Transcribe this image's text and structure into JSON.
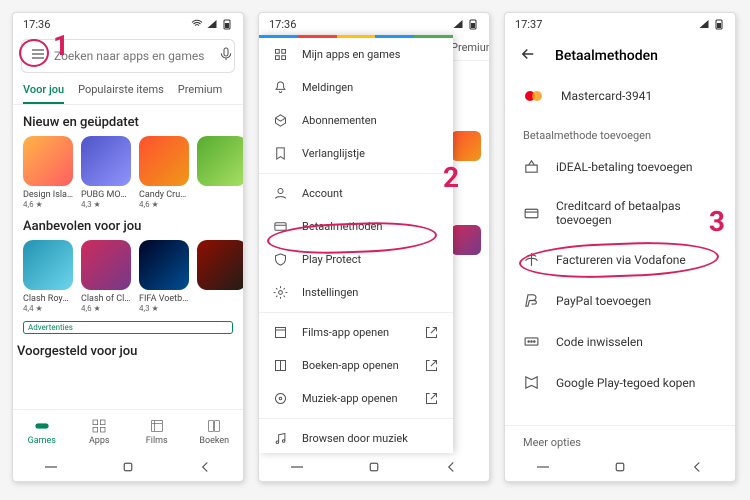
{
  "status": {
    "time1": "17:36",
    "time2": "17:36",
    "time3": "17:37"
  },
  "annotations": {
    "n1": "1",
    "n2": "2",
    "n3": "3"
  },
  "screen1": {
    "search_placeholder": "Zoeken naar apps en games",
    "tabs": [
      "Voor jou",
      "Populairste items",
      "Premium"
    ],
    "section1": "Nieuw en geüpdatet",
    "apps1": [
      {
        "name": "Design Island",
        "rating": "4,6 ★"
      },
      {
        "name": "PUBG MOBILE",
        "rating": "4,3 ★"
      },
      {
        "name": "Candy Crush Saga",
        "rating": "4,6 ★"
      },
      {
        "name": "",
        "rating": ""
      }
    ],
    "section2": "Aanbevolen voor jou",
    "apps2": [
      {
        "name": "Clash Royale",
        "rating": "4,4 ★"
      },
      {
        "name": "Clash of Clans",
        "rating": "4,6 ★"
      },
      {
        "name": "FIFA Voetbal",
        "rating": "4,3 ★"
      },
      {
        "name": "",
        "rating": ""
      }
    ],
    "ad_badge": "Advertenties",
    "section3": "Voorgesteld voor jou",
    "bottom": [
      "Games",
      "Apps",
      "Films",
      "Boeken"
    ]
  },
  "screen2": {
    "items_a": [
      "Mijn apps en games",
      "Meldingen",
      "Abonnementen",
      "Verlanglijstje"
    ],
    "items_b": [
      "Account",
      "Betaalmethoden",
      "Play Protect",
      "Instellingen"
    ],
    "items_c": [
      "Films-app openen",
      "Boeken-app openen",
      "Muziek-app openen"
    ],
    "items_d": [
      "Browsen door muziek"
    ],
    "peek_tab": "Premium"
  },
  "screen3": {
    "title": "Betaalmethoden",
    "card": "Mastercard-3941",
    "add_section": "Betaalmethode toevoegen",
    "methods": [
      "iDEAL-betaling toevoegen",
      "Creditcard of betaalpas toevoegen",
      "Factureren via Vodafone",
      "PayPal toevoegen",
      "Code inwisselen",
      "Google Play-tegoed kopen"
    ],
    "more": "Meer opties"
  }
}
